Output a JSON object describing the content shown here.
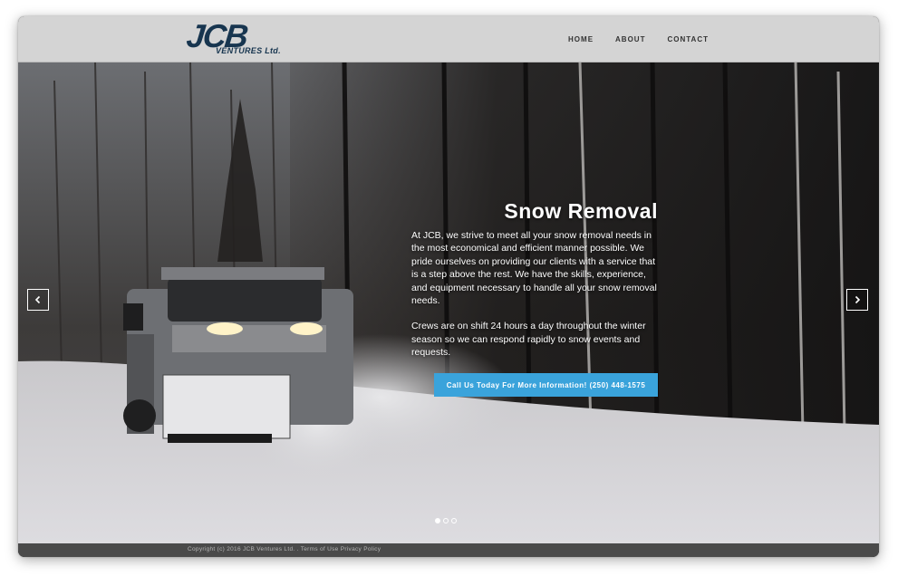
{
  "brand": {
    "logo_main": "JCB",
    "logo_sub": "VENTURES Ltd.",
    "logo_color": "#17354f"
  },
  "nav": {
    "items": [
      {
        "label": "HOME"
      },
      {
        "label": "ABOUT"
      },
      {
        "label": "CONTACT"
      }
    ]
  },
  "hero": {
    "title": "Snow Removal",
    "paragraphs": [
      "At JCB, we strive to meet all your snow removal needs in the most economical and efficient manner possible. We pride ourselves on providing our clients with a service that is a step above the rest. We have the skills, experience, and equipment necessary to handle all your snow removal needs.",
      "Crews are on shift 24 hours a day throughout the winter season so we can respond rapidly to snow events and requests."
    ],
    "cta_label": "Call Us Today For More Information! (250) 448-1575",
    "cta_color": "#3aa3db",
    "prev_icon": "chevron-left-icon",
    "next_icon": "chevron-right-icon"
  },
  "carousel": {
    "slide_count": 3,
    "active_index": 0
  },
  "footer": {
    "copyright": "Copyright (c) 2016 JCB Ventures Ltd. .",
    "links": [
      {
        "label": "Terms of Use"
      },
      {
        "label": "Privacy Policy"
      }
    ],
    "background": "#4a4a4a"
  }
}
